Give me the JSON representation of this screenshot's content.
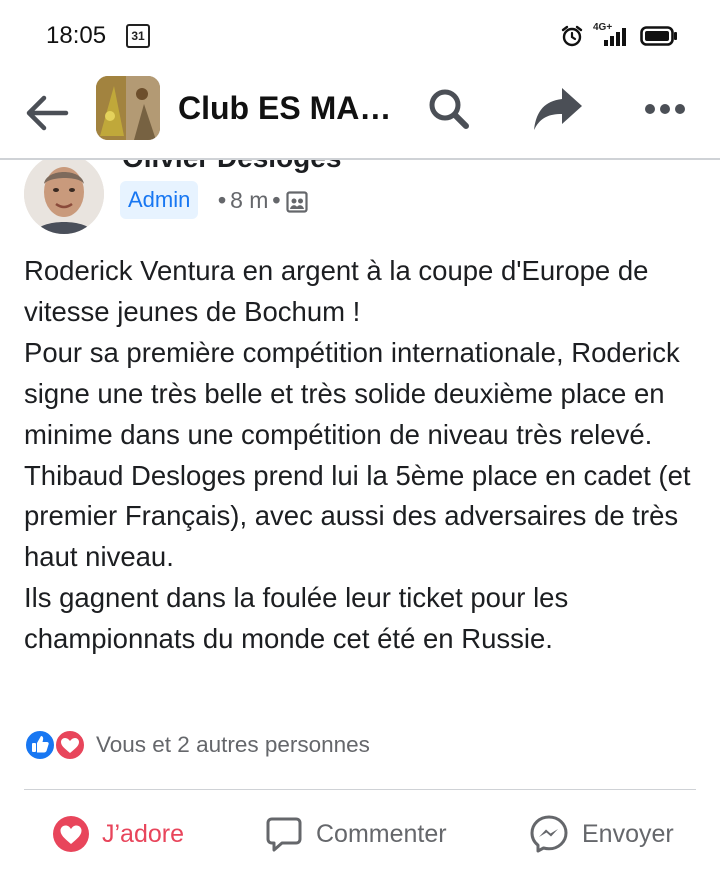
{
  "status_bar": {
    "time": "18:05",
    "calendar_day": "31",
    "network": "4G+"
  },
  "header": {
    "group_title": "Club ES MA…"
  },
  "post": {
    "author": "Olivier Desloges",
    "badge": "Admin",
    "time_ago": "8 m",
    "paragraphs": [
      "Roderick Ventura en argent à la coupe d'Europe de vitesse jeunes de Bochum !",
      "Pour sa première compétition internationale, Roderick signe une très belle et très solide deuxième place en minime dans une compétition de niveau très relevé.",
      "Thibaud Desloges prend lui la 5ème place en cadet (et premier Français), avec aussi des adversaires de très haut niveau.",
      "Ils gagnent dans la foulée leur ticket pour les championnats du monde cet été en Russie."
    ],
    "reaction_summary": "Vous et 2 autres personnes"
  },
  "actions": {
    "like": "J’adore",
    "comment": "Commenter",
    "send": "Envoyer"
  },
  "colors": {
    "accent_blue": "#1877f2",
    "love_red": "#e8455b",
    "muted_text": "#65676b",
    "badge_bg": "#e7f3ff"
  },
  "icons": [
    "back-arrow-icon",
    "search-icon",
    "share-icon",
    "more-icon",
    "like-icon",
    "love-icon",
    "comment-icon",
    "messenger-icon",
    "audience-icon"
  ]
}
